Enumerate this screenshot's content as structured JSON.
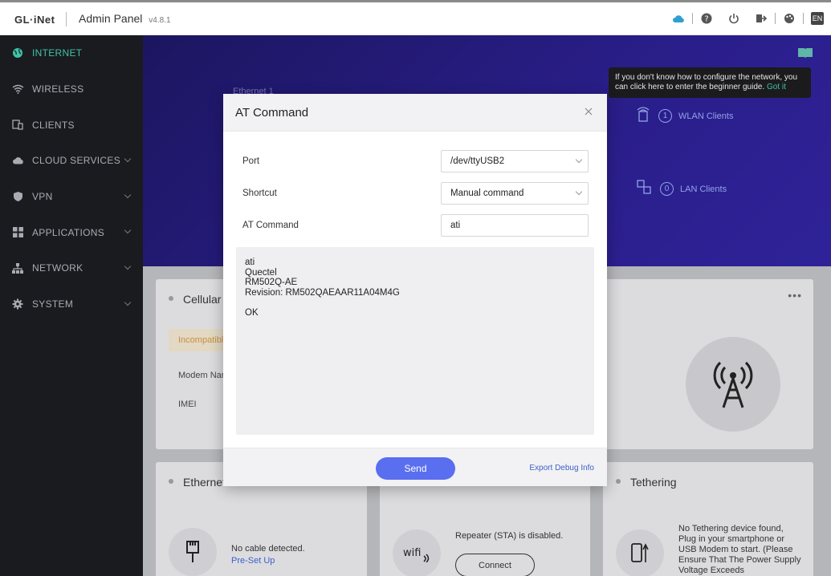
{
  "header": {
    "logo": "GL·iNet",
    "title": "Admin Panel",
    "version": "v4.8.1",
    "lang": "EN",
    "icons": [
      "cloud-icon",
      "help-icon",
      "power-icon",
      "logout-icon",
      "theme-icon",
      "language-icon"
    ]
  },
  "sidebar": {
    "items": [
      {
        "label": "INTERNET",
        "icon": "globe-icon",
        "active": true,
        "expandable": false
      },
      {
        "label": "WIRELESS",
        "icon": "wifi-icon",
        "active": false,
        "expandable": false
      },
      {
        "label": "CLIENTS",
        "icon": "clients-icon",
        "active": false,
        "expandable": false
      },
      {
        "label": "CLOUD SERVICES",
        "icon": "cloud-icon",
        "active": false,
        "expandable": true
      },
      {
        "label": "VPN",
        "icon": "shield-icon",
        "active": false,
        "expandable": true
      },
      {
        "label": "APPLICATIONS",
        "icon": "apps-icon",
        "active": false,
        "expandable": true
      },
      {
        "label": "NETWORK",
        "icon": "network-icon",
        "active": false,
        "expandable": true
      },
      {
        "label": "SYSTEM",
        "icon": "gear-icon",
        "active": false,
        "expandable": true
      }
    ],
    "active_color": "#3fc2a5"
  },
  "hero": {
    "ethernet_label": "Ethernet 1",
    "tooltip_text": "If you don't know how to configure the network, you can click here to enter the beginner guide.",
    "tooltip_link": "Got it",
    "wlan_count": "1",
    "wlan_label": "WLAN Clients",
    "lan_count": "0",
    "lan_label": "LAN Clients"
  },
  "cards": {
    "cellular": {
      "title": "Cellular",
      "status": "Incompatible",
      "modem_label": "Modem Name",
      "imei_label": "IMEI"
    },
    "ethernet": {
      "title": "Ethernet",
      "status": "No cable detected.",
      "link": "Pre-Set Up"
    },
    "repeater": {
      "status": "Repeater (STA) is disabled.",
      "button": "Connect"
    },
    "tethering": {
      "title": "Tethering",
      "status": "No Tethering device found, Plug in your smartphone or USB Modem to start. (Please Ensure That The Power Supply Voltage Exceeds"
    }
  },
  "modal": {
    "title": "AT Command",
    "port_label": "Port",
    "port_value": "/dev/ttyUSB2",
    "shortcut_label": "Shortcut",
    "shortcut_value": "Manual command",
    "command_label": "AT Command",
    "command_value": "ati",
    "output_lines": [
      "ati",
      "Quectel",
      "RM502Q-AE",
      "Revision: RM502QAEAAR11A04M4G",
      "",
      "OK"
    ],
    "send_label": "Send",
    "export_label": "Export Debug Info"
  },
  "colors": {
    "accent": "#5a6ef0",
    "link": "#3f60c9",
    "teal": "#3fc2a5",
    "hero": "#2a1e8a"
  }
}
